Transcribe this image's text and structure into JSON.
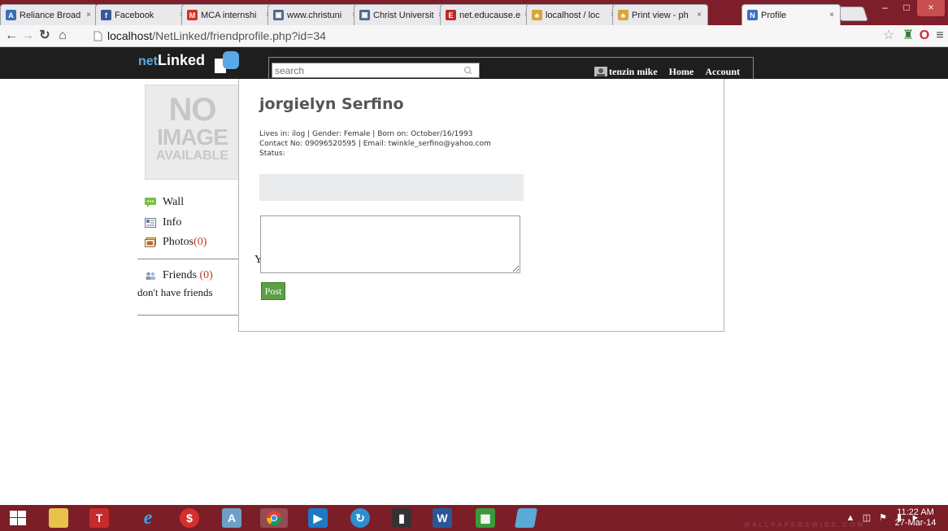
{
  "browser": {
    "tabs": [
      {
        "title": "Reliance Broad",
        "fav": "A",
        "fav_color": "#3b6fb6"
      },
      {
        "title": "Facebook",
        "fav": "f",
        "fav_color": "#3b5998"
      },
      {
        "title": "MCA internshi",
        "fav": "M",
        "fav_color": "#d93025"
      },
      {
        "title": "www.christuni",
        "fav": "▣",
        "fav_color": "#4a6b8a"
      },
      {
        "title": "Christ Universit",
        "fav": "▣",
        "fav_color": "#4a6b8a"
      },
      {
        "title": "net.educause.e",
        "fav": "E",
        "fav_color": "#c0282e"
      },
      {
        "title": "localhost / loc",
        "fav": "♣",
        "fav_color": "#d9a43b"
      },
      {
        "title": "Print view - ph",
        "fav": "♣",
        "fav_color": "#d9a43b"
      },
      {
        "title": "Profile",
        "fav": "N",
        "fav_color": "#3e6fc2"
      }
    ],
    "url_host": "localhost",
    "url_path": "/NetLinked/friendprofile.php?id=34",
    "window_controls": [
      "–",
      "□",
      "×"
    ]
  },
  "site": {
    "logo_net": "net",
    "logo_linked": "Linked",
    "search_placeholder": "search",
    "user_name": "tenzin mike",
    "nav_home": "Home",
    "nav_account": "Account"
  },
  "profile": {
    "no_image_l1": "NO",
    "no_image_l2": "IMAGE",
    "no_image_l3": "AVAILABLE",
    "name": "jorgielyn Serfino",
    "line1": "Lives in: ilog | Gender: Female | Born on: October/16/1993",
    "line2": "Contact No: 09096520595 | Email: twinkle_serfino@yahoo.com",
    "status_label": "Status:",
    "post_button": "Post"
  },
  "sidebar": {
    "wall": "Wall",
    "info": "Info",
    "photos": "Photos",
    "photos_count": "(0)",
    "friends": "Friends",
    "friends_count": "(0)",
    "no_friends": "don't have friends",
    "stray_text": "Y"
  },
  "taskbar": {
    "time": "11:22 AM",
    "date": "27-Mar-14",
    "watermark": "WALLPAPERSWIDE.COM"
  }
}
